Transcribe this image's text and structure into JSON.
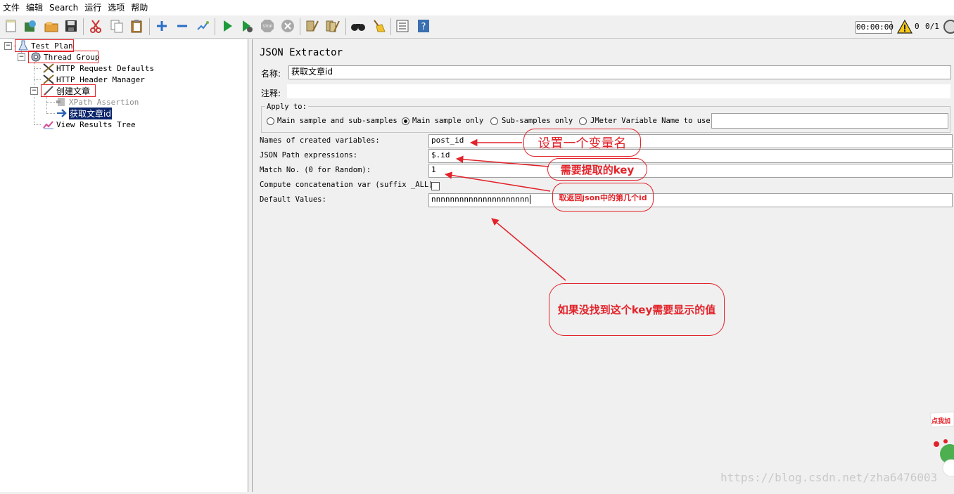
{
  "menu": [
    "文件",
    "编辑",
    "Search",
    "运行",
    "选项",
    "帮助"
  ],
  "toolbar": {
    "icons": [
      "new-icon",
      "templates-icon",
      "open-icon",
      "save-icon",
      "cut-icon",
      "copy-icon",
      "paste-icon",
      "expand-icon",
      "collapse-icon",
      "toggle-icon",
      "start-icon",
      "start-no-pause-icon",
      "stop-icon",
      "shutdown-icon",
      "clear-icon",
      "clear-all-icon",
      "search-icon",
      "reset-search-icon",
      "function-helper-icon",
      "help-icon"
    ],
    "timer": "00:00:00",
    "warnings": "0",
    "threads": "0/1"
  },
  "tree": {
    "nodes": [
      {
        "label": "Test Plan"
      },
      {
        "label": "Thread Group"
      },
      {
        "label": "HTTP Request Defaults"
      },
      {
        "label": "HTTP Header Manager"
      },
      {
        "label": "创建文章"
      },
      {
        "label": "XPath Assertion"
      },
      {
        "label": "获取文章id"
      },
      {
        "label": "View Results Tree"
      }
    ]
  },
  "panel": {
    "title": "JSON Extractor",
    "name_label": "名称:",
    "name_value": "获取文章id",
    "comments_label": "注释:",
    "comments_value": "",
    "apply_to": {
      "legend": "Apply to:",
      "options": [
        "Main sample and sub-samples",
        "Main sample only",
        "Sub-samples only",
        "JMeter Variable Name to use"
      ],
      "selected": "Main sample only",
      "variable_value": ""
    },
    "fields": [
      {
        "label": "Names of created variables:",
        "value": "post_id"
      },
      {
        "label": "JSON Path expressions:",
        "value": "$.id"
      },
      {
        "label": "Match No. (0 for Random):",
        "value": "1"
      },
      {
        "label": "Compute concatenation var (suffix _ALL):",
        "value": ""
      },
      {
        "label": "Default Values:",
        "value": "nnnnnnnnnnnnnnnnnnnnn"
      }
    ],
    "concat_checked": false
  },
  "annotations": [
    "设置一个变量名",
    "需要提取的key",
    "取返回json中的第几个id",
    "如果没找到这个key需要显示的值"
  ],
  "ad_text": "点我加",
  "watermark": "https://blog.csdn.net/zha6476003",
  "colors": {
    "annotation": "#e2232a",
    "selection": "#0a246a"
  }
}
